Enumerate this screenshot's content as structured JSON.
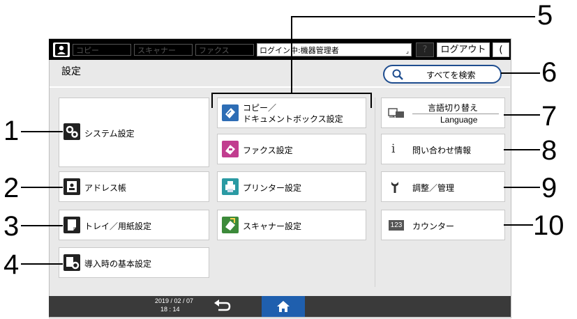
{
  "topbar": {
    "tabs": [
      "コピー",
      "スキャナー",
      "ファクス"
    ],
    "login_status": "ログイン中:機器管理者",
    "help_label": "?",
    "logout_label": "ログアウト",
    "sleep_label": "("
  },
  "header": {
    "title": "設定",
    "search_label": "すべてを検索"
  },
  "left_column": [
    {
      "label": "システム設定"
    },
    {
      "label": "アドレス帳"
    },
    {
      "label": "トレイ／用紙設定"
    },
    {
      "label": "導入時の基本設定"
    }
  ],
  "middle_column": [
    {
      "label_line1": "コピー／",
      "label_line2": "ドキュメントボックス設定"
    },
    {
      "label": "ファクス設定"
    },
    {
      "label": "プリンター設定"
    },
    {
      "label": "スキャナー設定"
    }
  ],
  "right_column": {
    "language": {
      "label_top": "言語切り替え",
      "label_bottom": "Language"
    },
    "inquiry": {
      "icon_text": "i",
      "label": "問い合わせ情報"
    },
    "maintenance": {
      "label": "調整／管理"
    },
    "counter": {
      "icon_text": "123",
      "label": "カウンター"
    }
  },
  "bottombar": {
    "date": "2019 / 02 / 07",
    "time": "18 : 14"
  },
  "callouts": [
    "1",
    "2",
    "3",
    "4",
    "5",
    "6",
    "7",
    "8",
    "9",
    "10"
  ],
  "colors": {
    "accent_blue": "#1e4d8f",
    "home_tab": "#1f5fae",
    "system_icon": "#222222",
    "copy_icon": "#2d6db5",
    "fax_icon": "#c13d8f",
    "printer_icon": "#2a9aa3",
    "scanner_icon": "#3c8a3a"
  }
}
